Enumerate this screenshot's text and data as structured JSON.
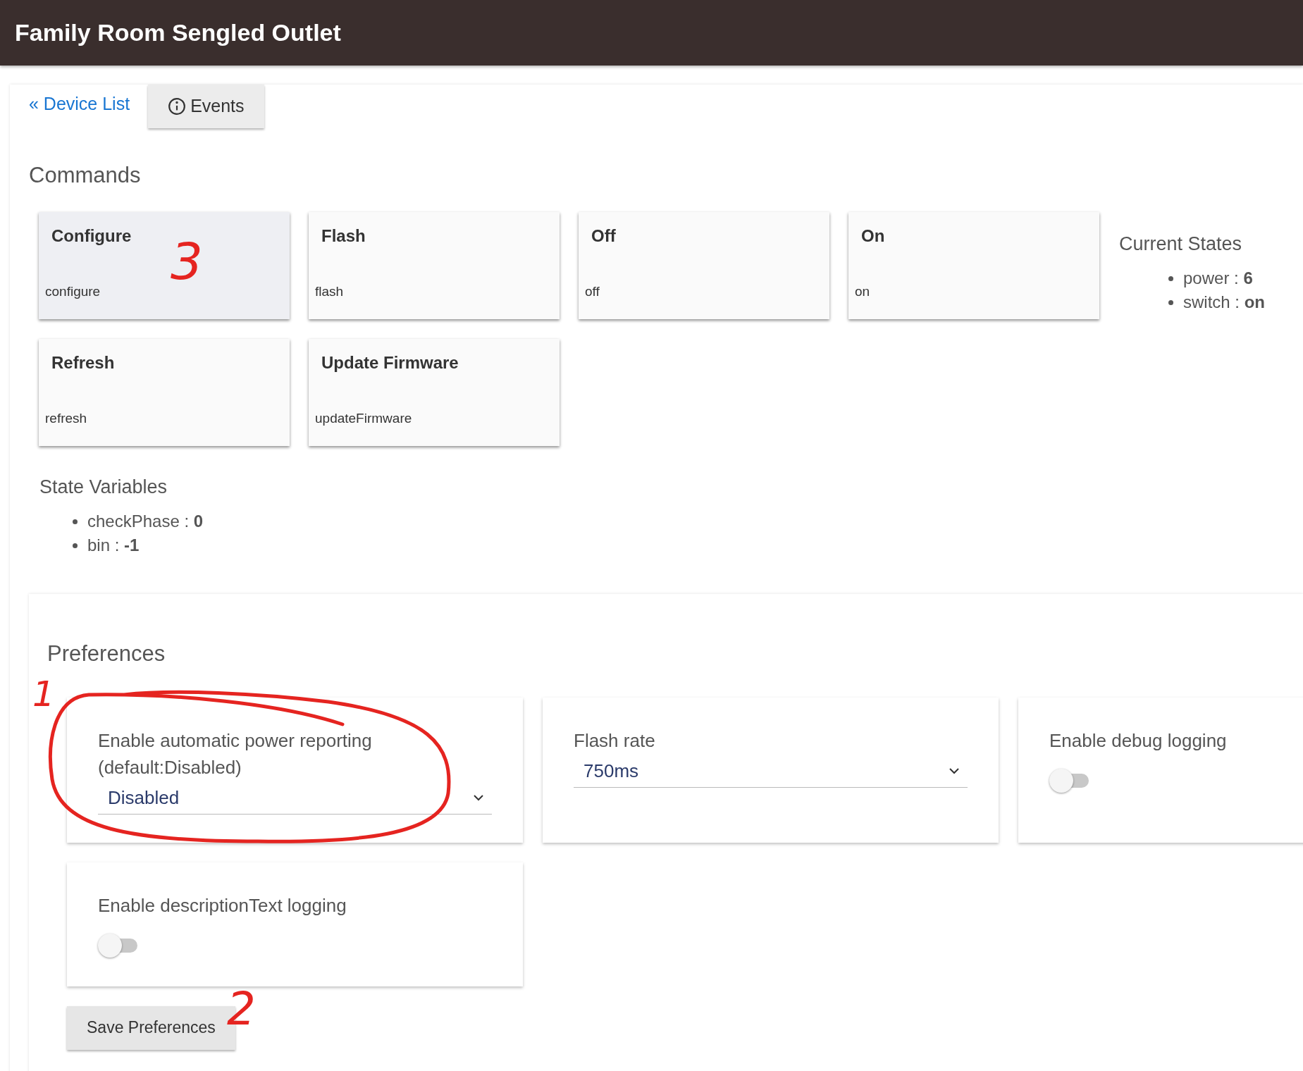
{
  "header": {
    "title": "Family Room Sengled Outlet"
  },
  "nav": {
    "back_link": "« Device List",
    "events_button": "Events"
  },
  "commands": {
    "heading": "Commands",
    "items": [
      {
        "label": "Configure",
        "name": "configure",
        "selected": true
      },
      {
        "label": "Flash",
        "name": "flash",
        "selected": false
      },
      {
        "label": "Off",
        "name": "off",
        "selected": false
      },
      {
        "label": "On",
        "name": "on",
        "selected": false
      },
      {
        "label": "Refresh",
        "name": "refresh",
        "selected": false
      },
      {
        "label": "Update Firmware",
        "name": "updateFirmware",
        "selected": false
      }
    ]
  },
  "current_states": {
    "heading": "Current States",
    "items": [
      "power : **6**",
      "switch : **on**"
    ]
  },
  "state_variables": {
    "heading": "State Variables",
    "items": [
      "checkPhase : **0**",
      "bin : **-1**"
    ]
  },
  "preferences": {
    "heading": "Preferences",
    "items": [
      {
        "kind": "select",
        "label": "Enable automatic power reporting (default:Disabled)",
        "value": "Disabled"
      },
      {
        "kind": "select",
        "label": "Flash rate",
        "value": "750ms"
      },
      {
        "kind": "toggle",
        "label": "Enable debug logging",
        "on": false
      },
      {
        "kind": "toggle",
        "label": "Enable descriptionText logging",
        "on": false
      }
    ],
    "save_button": "Save Preferences"
  },
  "annotations": [
    "3",
    "1",
    "2"
  ]
}
